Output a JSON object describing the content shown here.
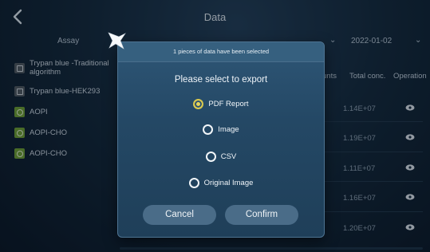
{
  "header": {
    "title": "Data"
  },
  "filters": {
    "assay_label": "Assay",
    "date_value": "2022-01-02"
  },
  "assays": [
    {
      "label": "Trypan blue -Traditional algorithm",
      "icon": "cell-icon",
      "color": "#525b63"
    },
    {
      "label": "Trypan blue-HEK293",
      "icon": "cell-icon",
      "color": "#525b63"
    },
    {
      "label": "AOPI",
      "icon": "fluorescence-icon",
      "color": "#6fa035"
    },
    {
      "label": "AOPI-CHO",
      "icon": "fluorescence-icon",
      "color": "#6fa035"
    },
    {
      "label": "AOPI-CHO",
      "icon": "fluorescence-icon",
      "color": "#6fa035"
    }
  ],
  "table": {
    "columns": [
      "unts",
      "Total conc.",
      "Operation"
    ],
    "rows": [
      {
        "total_conc": "1.14E+07"
      },
      {
        "total_conc": "1.19E+07"
      },
      {
        "total_conc": "1.11E+07"
      },
      {
        "total_conc": "1.16E+07"
      },
      {
        "total_conc": "1.20E+07"
      }
    ]
  },
  "dialog": {
    "header": "1 pieces of data have been selected",
    "title": "Please select to export",
    "options": [
      {
        "label": "PDF Report",
        "selected": true
      },
      {
        "label": "Image",
        "selected": false
      },
      {
        "label": "CSV",
        "selected": false
      },
      {
        "label": "Original Image",
        "selected": false
      }
    ],
    "cancel_label": "Cancel",
    "confirm_label": "Confirm"
  },
  "colors": {
    "accent_selected": "#e6d45a",
    "dialog_bg": "#244865",
    "button_bg": "#4a6c88",
    "assay_green": "#6fa035"
  }
}
